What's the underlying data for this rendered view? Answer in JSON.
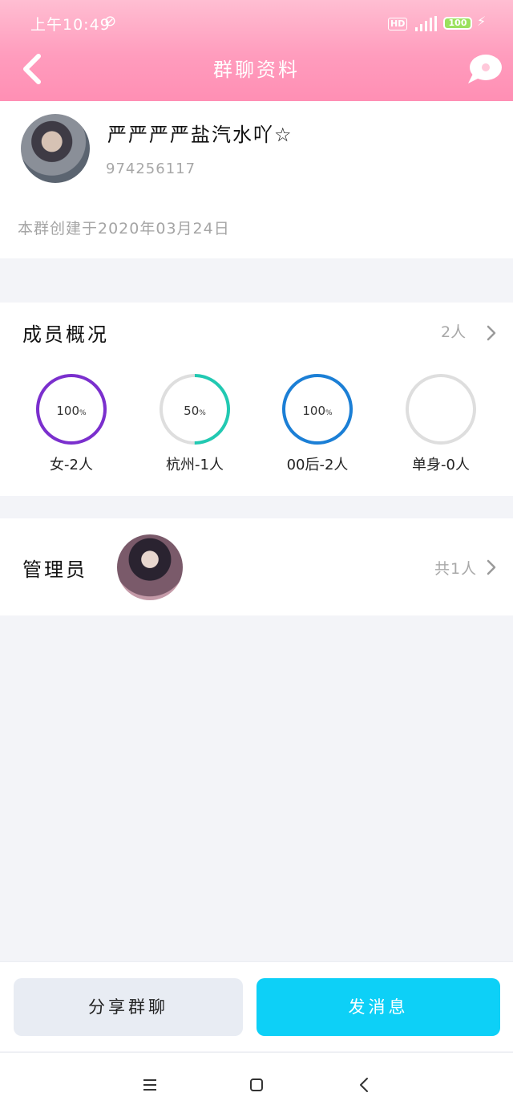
{
  "status_bar": {
    "time": "上午10:49",
    "hd": "HD",
    "battery": "100"
  },
  "nav": {
    "title": "群聊资料",
    "back_icon": "chevron-left-icon",
    "more_icon": "chat-bubble-icon"
  },
  "group": {
    "name": "严严严严盐汽水吖☆",
    "id": "974256117",
    "created": "本群创建于2020年03月24日"
  },
  "members": {
    "title": "成员概况",
    "count": "2人",
    "stats": [
      {
        "pct": "100",
        "percent_unit": "%",
        "label": "女-2人",
        "fraction": 1.0,
        "color": "#7b2fce"
      },
      {
        "pct": "50",
        "percent_unit": "%",
        "label": "杭州-1人",
        "fraction": 0.5,
        "color": "#21c9b2"
      },
      {
        "pct": "100",
        "percent_unit": "%",
        "label": "00后-2人",
        "fraction": 1.0,
        "color": "#1b7fd6"
      },
      {
        "pct": "",
        "percent_unit": "",
        "label": "单身-0人",
        "fraction": 0.0,
        "color": "#dcdcdc"
      }
    ]
  },
  "admins": {
    "title": "管理员",
    "count": "共1人"
  },
  "actions": {
    "share": "分享群聊",
    "send": "发消息"
  },
  "colors": {
    "header_pink": "#ff9cbd",
    "send_button": "#0dd0f7",
    "ring_track": "#dedede"
  }
}
